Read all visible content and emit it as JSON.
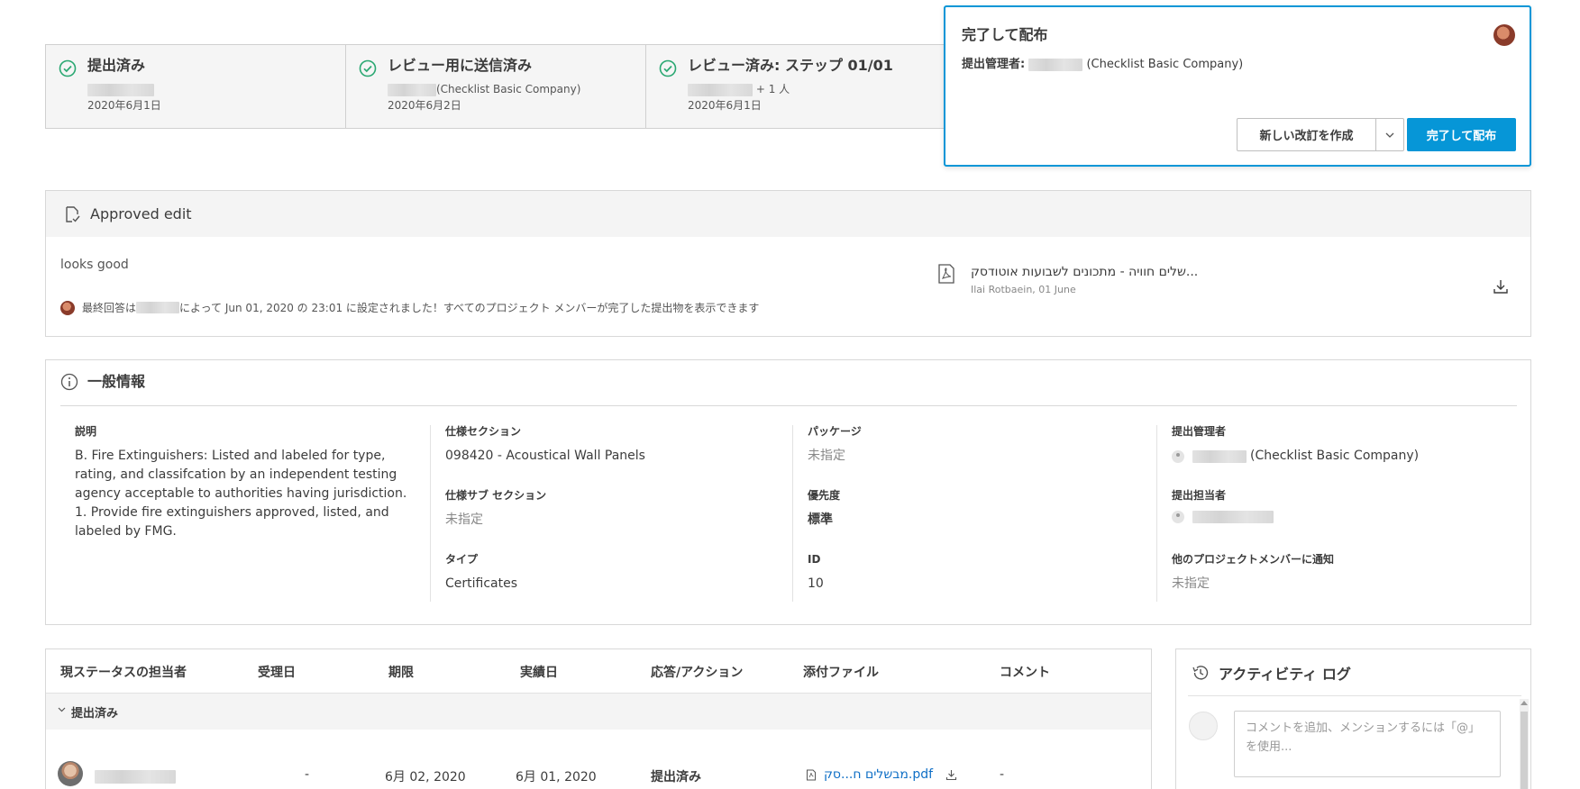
{
  "steps": [
    {
      "title": "提出済み",
      "company": "",
      "date": "2020年6月1日"
    },
    {
      "title": "レビュー用に送信済み",
      "company": "(Checklist Basic Company)",
      "date": "2020年6月2日"
    },
    {
      "title": "レビュー済み: ステップ 01/01",
      "extra": "+ 1 人",
      "date": "2020年6月1日"
    }
  ],
  "popup": {
    "title": "完了して配布",
    "manager_label": "提出管理者:",
    "manager_company": "(Checklist Basic Company)",
    "new_revision_label": "新しい改訂を作成",
    "done_label": "完了して配布"
  },
  "approved": {
    "title": "Approved edit",
    "comment": "looks good",
    "final_prefix": "最終回答は",
    "final_suffix": "によって Jun 01, 2020 の 23:01 に設定されました！すべてのプロジェクト メンバーが完了した提出物を表示できます",
    "file_name": "שלים חוויה - מתכונים לשבועות אוטודסק...",
    "file_meta": "Ilai Rotbaein, 01 June"
  },
  "general": {
    "title": "一般情報",
    "description_label": "説明",
    "description": "B. Fire Extinguishers: Listed and labeled for type, rating, and classifcation by an independent testing agency acceptable to authorities having jurisdiction.\n1. Provide fire extinguishers approved, listed, and labeled by FMG.",
    "spec_section_label": "仕様セクション",
    "spec_section": "098420 - Acoustical Wall Panels",
    "spec_sub_label": "仕様サブ セクション",
    "spec_sub": "未指定",
    "type_label": "タイプ",
    "type": "Certificates",
    "package_label": "パッケージ",
    "package": "未指定",
    "priority_label": "優先度",
    "priority": "標準",
    "id_label": "ID",
    "id": "10",
    "manager_label": "提出管理者",
    "manager_company": "(Checklist Basic Company)",
    "owner_label": "提出担当者",
    "notify_label": "他のプロジェクトメンバーに通知",
    "notify": "未指定"
  },
  "table": {
    "headers": [
      "現ステータスの担当者",
      "受理日",
      "期限",
      "実績日",
      "応答/アクション",
      "添付ファイル",
      "コメント"
    ],
    "group": "提出済み",
    "row": {
      "received": "-",
      "due": "6月 02, 2020",
      "actual": "6月 01, 2020",
      "action": "提出済み",
      "attachment": "מבשלים ח...סק.pdf",
      "comment": "-"
    }
  },
  "activity": {
    "title": "アクティビティ ログ",
    "placeholder": "コメントを追加、メンションするには「@」を使用..."
  },
  "colors": {
    "accent": "#0696d7",
    "check": "#2aa872",
    "link": "#0f6fc6"
  }
}
